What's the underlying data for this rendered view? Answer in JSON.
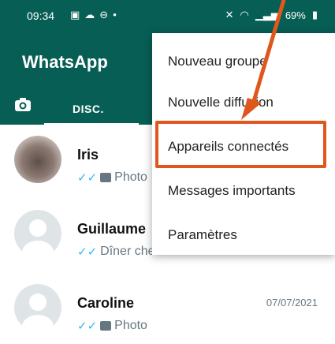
{
  "status_bar": {
    "time": "09:34",
    "battery": "69%"
  },
  "app": {
    "title": "WhatsApp",
    "active_tab": "DISC."
  },
  "chats": [
    {
      "name": "Iris",
      "preview": "Photo",
      "date": ""
    },
    {
      "name": "Guillaume",
      "preview": "Dîner che",
      "date": ""
    },
    {
      "name": "Caroline",
      "preview": "Photo",
      "date": "07/07/2021"
    }
  ],
  "menu": {
    "items": [
      {
        "label": "Nouveau groupe"
      },
      {
        "label": "Nouvelle diffusion"
      },
      {
        "label": "Appareils connectés"
      },
      {
        "label": "Messages importants"
      },
      {
        "label": "Paramètres"
      }
    ],
    "highlighted_index": 2
  },
  "colors": {
    "header": "#075e54",
    "highlight": "#e0571e",
    "ticks": "#34b7f1"
  }
}
